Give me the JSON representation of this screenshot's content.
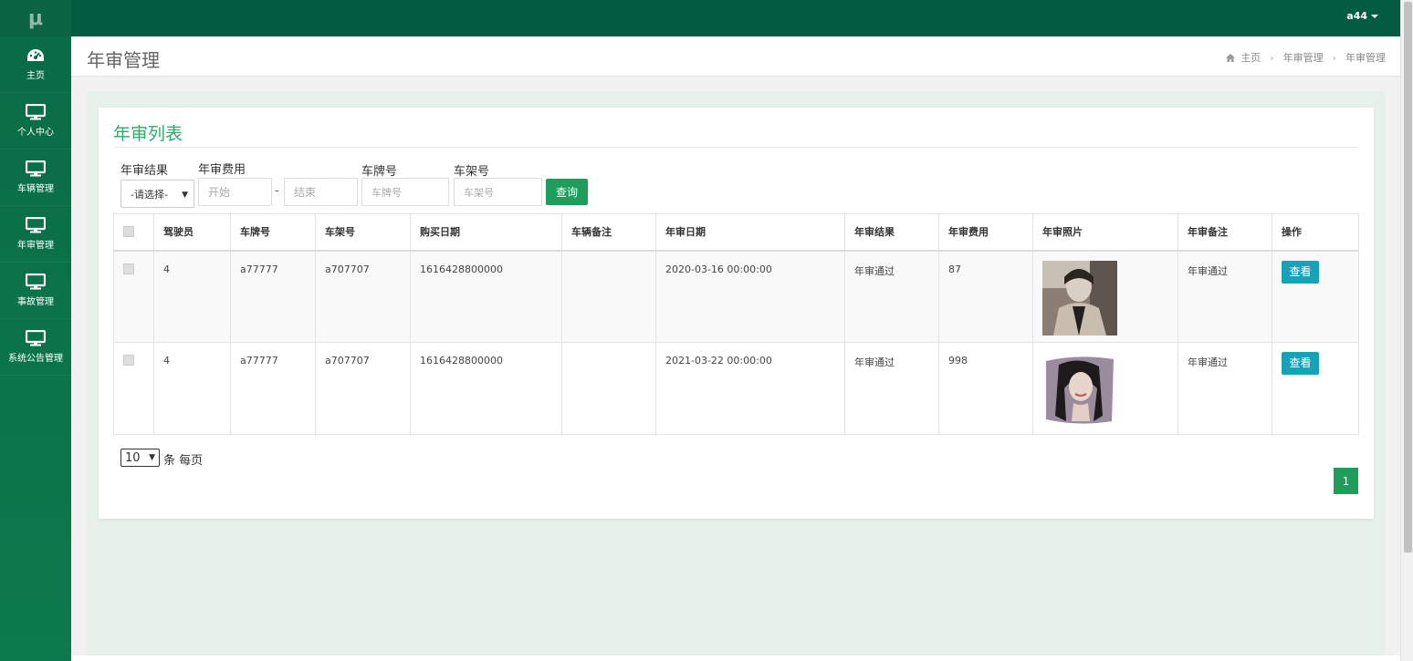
{
  "app": {
    "logo": "μ",
    "user": "a44"
  },
  "sidebar": {
    "items": [
      {
        "label": "主页",
        "icon": "dashboard-icon"
      },
      {
        "label": "个人中心",
        "icon": "monitor-icon"
      },
      {
        "label": "车辆管理",
        "icon": "monitor-icon"
      },
      {
        "label": "年审管理",
        "icon": "monitor-icon"
      },
      {
        "label": "事故管理",
        "icon": "monitor-icon"
      },
      {
        "label": "系统公告管理",
        "icon": "monitor-icon"
      }
    ]
  },
  "header": {
    "title": "年审管理",
    "breadcrumb": [
      "主页",
      "年审管理",
      "年审管理"
    ],
    "home_icon": "home-icon"
  },
  "card": {
    "title": "年审列表"
  },
  "filters": {
    "result_label": "年审结果",
    "result_value": "-请选择-",
    "fee_label": "年审费用",
    "fee_start_placeholder": "开始",
    "fee_end_placeholder": "结束",
    "fee_separator": "-",
    "plate_label": "车牌号",
    "plate_placeholder": "车牌号",
    "vin_label": "车架号",
    "vin_placeholder": "车架号",
    "search_button": "查询"
  },
  "table": {
    "columns": [
      "驾驶员",
      "车牌号",
      "车架号",
      "购买日期",
      "车辆备注",
      "年审日期",
      "年审结果",
      "年审费用",
      "年审照片",
      "年审备注",
      "操作"
    ],
    "rows": [
      {
        "driver": "4",
        "plate": "a77777",
        "vin": "a707707",
        "purchase_date": "1616428800000",
        "vehicle_note": "",
        "review_date": "2020-03-16 00:00:00",
        "result": "年审通过",
        "fee": "87",
        "photo": "photo-1",
        "review_note": "年审通过",
        "action": "查看"
      },
      {
        "driver": "4",
        "plate": "a77777",
        "vin": "a707707",
        "purchase_date": "1616428800000",
        "vehicle_note": "",
        "review_date": "2021-03-22 00:00:00",
        "result": "年审通过",
        "fee": "998",
        "photo": "photo-2",
        "review_note": "年审通过",
        "action": "查看"
      }
    ]
  },
  "pagination": {
    "page_size": "10",
    "page_size_suffix": "条 每页",
    "current_page": "1"
  },
  "colors": {
    "sidebar": "#0a6b46",
    "topbar": "#035c40",
    "accent": "#1e9e5a",
    "title": "#2eaa6a",
    "view_button": "#17a2b8"
  }
}
